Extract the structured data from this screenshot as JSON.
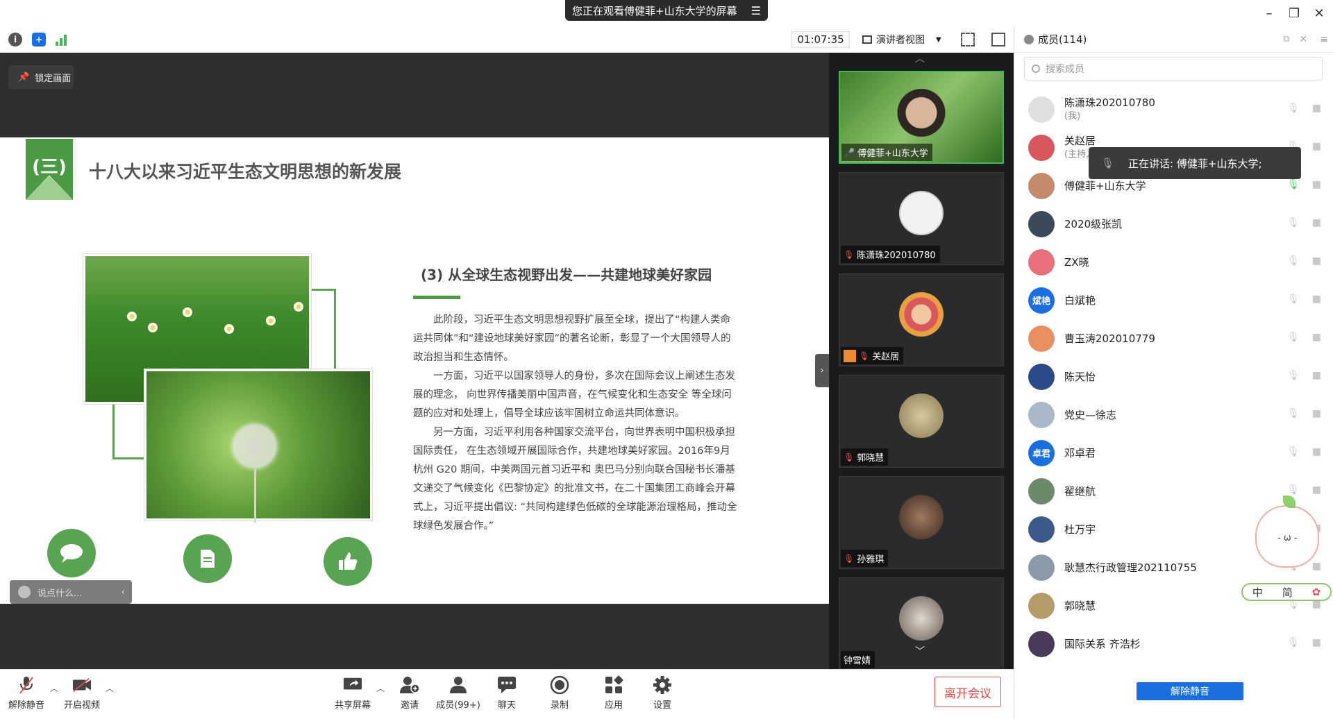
{
  "window": {
    "share_banner": "您正在观看傅健菲+山东大学的屏幕",
    "minimize": "–",
    "restore": "❐",
    "close": "✕"
  },
  "toolbar": {
    "timer": "01:07:35",
    "view_mode": "演讲者视图"
  },
  "stage": {
    "lock_label": "锁定画面",
    "chat_placeholder": "说点什么..."
  },
  "slide": {
    "section_tag": "(三)",
    "title": "十八大以来习近平生态文明思想的新发展",
    "subtitle": "(3) 从全球生态视野出发——共建地球美好家园",
    "paragraphs": [
      "此阶段，习近平生态文明思想视野扩展至全球，提出了“构建人类命运共同体”和“建设地球美好家园”的著名论断，彰显了一个大国领导人的政治担当和生态情怀。",
      "一方面，习近平以国家领导人的身份，多次在国际会议上阐述生态发展的理念， 向世界传播美丽中国声音，在气候变化和生态安全 等全球问题的应对和处理上，倡导全球应该牢固树立命运共同体意识。",
      "另一方面，习近平利用各种国家交流平台，向世界表明中国积极承担国际责任， 在生态领域开展国际合作，共建地球美好家园。2016年9月杭州 G20 期间，中美两国元首习近平和 奥巴马分别向联合国秘书长潘基文递交了气候变化《巴黎协定》的批准文书，在二十国集团工商峰会开幕式上，习近平提出倡议: “共同构建绿色低碳的全球能源治理格局，推动全球绿色发展合作。”"
    ]
  },
  "video_tiles": [
    {
      "name": "傅健菲+山东大学",
      "mic": "on",
      "active": true,
      "avatar_color": "#4b8a3a"
    },
    {
      "name": "陈潇珠202010780",
      "mic": "off",
      "active": false,
      "avatar_color": "#f2f2f2"
    },
    {
      "name": "关赵居",
      "mic": "off",
      "active": false,
      "avatar_color": "#d8585c"
    },
    {
      "name": "郭晓慧",
      "mic": "off",
      "active": false,
      "avatar_color": "#b59a6a"
    },
    {
      "name": "孙雅琪",
      "mic": "off",
      "active": false,
      "avatar_color": "#6e5040"
    },
    {
      "name": "钟雪婧",
      "mic": "none",
      "active": false,
      "avatar_color": "#c9c4bd"
    }
  ],
  "bottombar": {
    "unmute": "解除静音",
    "start_video": "开启视频",
    "share_screen": "共享屏幕",
    "invite": "邀请",
    "members": "成员(99+)",
    "chat": "聊天",
    "record": "录制",
    "apps": "应用",
    "settings": "设置",
    "leave": "离开会议"
  },
  "members_panel": {
    "title": "成员(114)",
    "search_placeholder": "搜索成员",
    "speaking_tip": "正在讲话: 傅健菲+山东大学;",
    "unmute_all": "解除静音",
    "members": [
      {
        "name": "陈潇珠202010780",
        "sub": "(我)",
        "avatar_text": "",
        "avatar_color": "#e0e0e0"
      },
      {
        "name": "关赵居",
        "sub": "(主持人)",
        "avatar_text": "",
        "avatar_color": "#d8585c"
      },
      {
        "name": "傅健菲+山东大学",
        "sub": "",
        "avatar_text": "",
        "avatar_color": "#c48a6a"
      },
      {
        "name": "2020级张凯",
        "sub": "",
        "avatar_text": "",
        "avatar_color": "#3a4a5a"
      },
      {
        "name": "ZX晓",
        "sub": "",
        "avatar_text": "",
        "avatar_color": "#e8707a"
      },
      {
        "name": "白斌艳",
        "sub": "",
        "avatar_text": "斌艳",
        "avatar_color": "#1a6fe0"
      },
      {
        "name": "曹玉涛202010779",
        "sub": "",
        "avatar_text": "",
        "avatar_color": "#e89060"
      },
      {
        "name": "陈天怡",
        "sub": "",
        "avatar_text": "",
        "avatar_color": "#2a4a8a"
      },
      {
        "name": "党史—徐志",
        "sub": "",
        "avatar_text": "",
        "avatar_color": "#a8b8c8"
      },
      {
        "name": "邓卓君",
        "sub": "",
        "avatar_text": "卓君",
        "avatar_color": "#1a6fe0"
      },
      {
        "name": "翟继航",
        "sub": "",
        "avatar_text": "",
        "avatar_color": "#6a8a6a"
      },
      {
        "name": "杜万宇",
        "sub": "",
        "avatar_text": "",
        "avatar_color": "#3a5a8a"
      },
      {
        "name": "耿慧杰行政管理202110755",
        "sub": "",
        "avatar_text": "",
        "avatar_color": "#8a9aa8"
      },
      {
        "name": "郭晓慧",
        "sub": "",
        "avatar_text": "",
        "avatar_color": "#b59a6a"
      },
      {
        "name": "国际关系 齐浩杉",
        "sub": "",
        "avatar_text": "",
        "avatar_color": "#4a3a5a"
      }
    ]
  },
  "ime": {
    "lang": "中",
    "mode": "简"
  },
  "colors": {
    "accent": "#58a452",
    "leave": "#e54a4a",
    "brand_blue": "#1a6fe0",
    "stage_bg": "#2d2e30"
  }
}
